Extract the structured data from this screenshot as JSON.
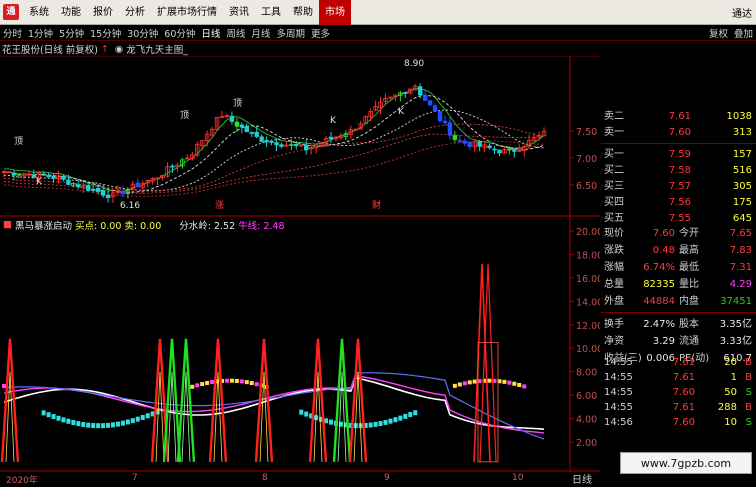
{
  "menu": {
    "items": [
      "系统",
      "功能",
      "报价",
      "分析",
      "扩展市场行情",
      "资讯",
      "工具",
      "帮助",
      "市场"
    ],
    "active_index": 8,
    "right_label": "通达"
  },
  "toolbar": {
    "periods": [
      "分时",
      "1分钟",
      "5分钟",
      "15分钟",
      "30分钟",
      "60分钟",
      "日线",
      "周线",
      "月线",
      "多周期",
      "更多"
    ],
    "selected_index": 6,
    "right": [
      "复权",
      "叠加"
    ]
  },
  "chart_header": {
    "stock": "花王股份(日线 前复权)",
    "indicator": "龙飞九天主图_"
  },
  "main_chart": {
    "price_axis": [
      "7.50",
      "7.00",
      "6.50"
    ],
    "high_label": "8.90",
    "low_label": "6.16",
    "markers": [
      "顶",
      "顶",
      "顶",
      "涨",
      "财",
      "K",
      "K",
      "K"
    ]
  },
  "indicator_header": {
    "name": "黑马暴涨启动",
    "buy_label": "买点: 0.00",
    "sell_label": "卖: 0.00",
    "water_label": "分水岭: 2.52",
    "bull_label": "牛线: 2.48"
  },
  "indicator_axis": [
    "20.00",
    "18.00",
    "16.00",
    "14.00",
    "12.00",
    "10.00",
    "8.00",
    "6.00",
    "4.00",
    "2.00"
  ],
  "dates": [
    "2020年",
    "7",
    "8",
    "9",
    "10"
  ],
  "order_book": {
    "asks": [
      {
        "label": "卖二",
        "price": "7.61",
        "vol": "1038"
      },
      {
        "label": "卖一",
        "price": "7.60",
        "vol": "313"
      }
    ],
    "bids": [
      {
        "label": "买一",
        "price": "7.59",
        "vol": "157"
      },
      {
        "label": "买二",
        "price": "7.58",
        "vol": "516"
      },
      {
        "label": "买三",
        "price": "7.57",
        "vol": "305"
      },
      {
        "label": "买四",
        "price": "7.56",
        "vol": "175"
      },
      {
        "label": "买五",
        "price": "7.55",
        "vol": "645"
      }
    ]
  },
  "stats": [
    {
      "l1": "现价",
      "v1": "7.60",
      "c1": "red",
      "l2": "今开",
      "v2": "7.65",
      "c2": "red"
    },
    {
      "l1": "涨跌",
      "v1": "0.48",
      "c1": "red",
      "l2": "最高",
      "v2": "7.83",
      "c2": "red"
    },
    {
      "l1": "涨幅",
      "v1": "6.74%",
      "c1": "red",
      "l2": "最低",
      "v2": "7.31",
      "c2": "red"
    },
    {
      "l1": "总量",
      "v1": "82335",
      "c1": "yellow",
      "l2": "量比",
      "v2": "4.29",
      "c2": "purple"
    },
    {
      "l1": "外盘",
      "v1": "44884",
      "c1": "red",
      "l2": "内盘",
      "v2": "37451",
      "c2": "green"
    },
    {
      "l1": "换手",
      "v1": "2.47%",
      "c1": "white",
      "l2": "股本",
      "v2": "3.35亿",
      "c2": "white"
    },
    {
      "l1": "净资",
      "v1": "3.29",
      "c1": "white",
      "l2": "流通",
      "v2": "3.33亿",
      "c2": "white"
    },
    {
      "l1": "收益(三)",
      "v1": "0.006",
      "c1": "white",
      "l2": "PE(动)",
      "v2": "610.7",
      "c2": "white"
    }
  ],
  "trades": [
    {
      "time": "14:55",
      "price": "7.61",
      "vol": "20",
      "side": "B"
    },
    {
      "time": "14:55",
      "price": "7.61",
      "vol": "1",
      "side": "B"
    },
    {
      "time": "14:55",
      "price": "7.60",
      "vol": "50",
      "side": "S"
    },
    {
      "time": "14:55",
      "price": "7.61",
      "vol": "288",
      "side": "B"
    },
    {
      "time": "14:56",
      "price": "7.60",
      "vol": "10",
      "side": "S"
    }
  ],
  "bottom_tab": "日线",
  "watermark": "www.7gpzb.com",
  "colors": {
    "up": "#ff3a3a",
    "down": "#20d0d0",
    "background": "#000000"
  }
}
